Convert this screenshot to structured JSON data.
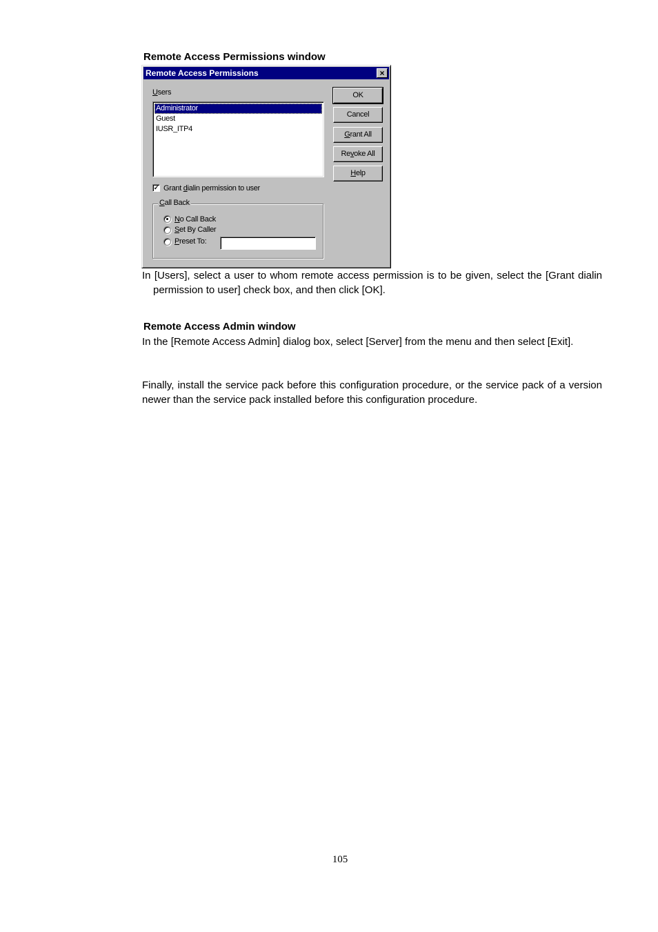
{
  "section1": {
    "heading": "Remote Access Permissions window",
    "dialog": {
      "title": "Remote Access Permissions",
      "close_icon": "×",
      "users_label": {
        "mnemonic": "U",
        "rest": "sers"
      },
      "users": [
        {
          "name": "Administrator",
          "selected": true
        },
        {
          "name": "Guest",
          "selected": false
        },
        {
          "name": "IUSR_ITP4",
          "selected": false
        }
      ],
      "buttons": {
        "ok": {
          "pre": "OK",
          "mnemonic": "",
          "post": ""
        },
        "cancel": {
          "pre": "Cancel",
          "mnemonic": "",
          "post": ""
        },
        "grant_all": {
          "pre": "",
          "mnemonic": "G",
          "post": "rant All"
        },
        "revoke_all": {
          "pre": "Re",
          "mnemonic": "v",
          "post": "oke All"
        },
        "help": {
          "pre": "",
          "mnemonic": "H",
          "post": "elp"
        }
      },
      "grant_checkbox": {
        "checked": true,
        "check_glyph": "✓",
        "pre": "Grant ",
        "mnemonic": "d",
        "post": "ialin permission to user"
      },
      "callback_group": {
        "title": {
          "mnemonic": "C",
          "rest": "all Back"
        },
        "options": [
          {
            "mnemonic": "N",
            "rest": "o Call Back",
            "checked": true
          },
          {
            "mnemonic": "S",
            "rest": "et By Caller",
            "checked": false
          },
          {
            "mnemonic": "P",
            "rest": "reset To:",
            "checked": false
          }
        ],
        "preset_value": ""
      }
    },
    "instruction": "In [Users], select a user to whom remote access permission is to be given, select the [Grant dialin permission to user] check box, and then click [OK]."
  },
  "section2": {
    "heading": "Remote Access Admin window",
    "instruction": "In the [Remote Access Admin] dialog box, select [Server] from the menu and then select [Exit]."
  },
  "final_note": "Finally, install the service pack before this configuration procedure, or the service pack of a version newer than the service pack installed before this configuration procedure.",
  "page_number": "105"
}
